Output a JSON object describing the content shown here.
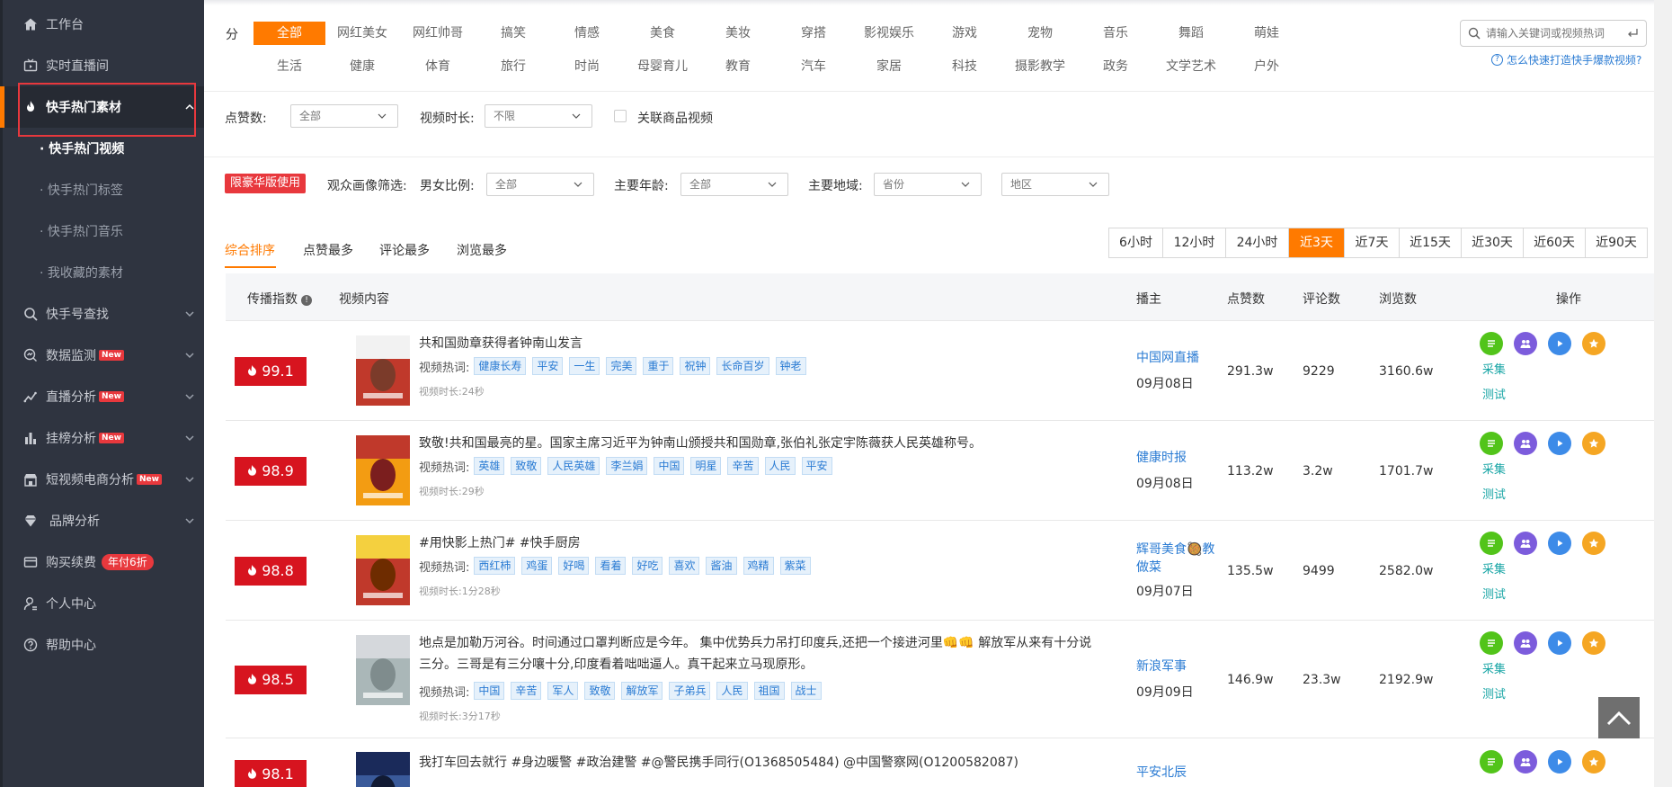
{
  "sidebar": {
    "items": [
      {
        "label": "工作台",
        "icon": "home-icon"
      },
      {
        "label": "实时直播间",
        "icon": "live-icon"
      },
      {
        "label": "快手热门素材",
        "icon": "fire-icon"
      },
      {
        "label": "快手号查找",
        "icon": "search-icon"
      },
      {
        "label": "数据监测",
        "icon": "monitor-icon",
        "badge": "New"
      },
      {
        "label": "直播分析",
        "icon": "trend-icon",
        "badge": "New"
      },
      {
        "label": "挂榜分析",
        "icon": "bar-chart-icon",
        "badge": "New"
      },
      {
        "label": "短视频电商分析",
        "icon": "shop-icon",
        "badge": "New"
      },
      {
        "label": "品牌分析",
        "icon": "diamond-icon"
      },
      {
        "label": "购买续费",
        "icon": "card-icon",
        "badge": "年付6折"
      },
      {
        "label": "个人中心",
        "icon": "user-icon"
      },
      {
        "label": "帮助中心",
        "icon": "help-icon"
      }
    ],
    "subitems": [
      "· 快手热门视频",
      "· 快手热门标签",
      "· 快手热门音乐",
      "· 我收藏的素材"
    ]
  },
  "filters": {
    "category_label": "分 类:",
    "categories_row1": [
      "全部",
      "网红美女",
      "网红帅哥",
      "搞笑",
      "情感",
      "美食",
      "美妆",
      "穿搭",
      "影视娱乐",
      "游戏",
      "宠物",
      "音乐",
      "舞蹈",
      "萌娃"
    ],
    "categories_row2": [
      "生活",
      "健康",
      "体育",
      "旅行",
      "时尚",
      "母婴育儿",
      "教育",
      "汽车",
      "家居",
      "科技",
      "摄影教学",
      "政务",
      "文学艺术",
      "户外"
    ],
    "search_placeholder": "请输入关键词或视频热词",
    "help_link": "怎么快速打造快手爆款视频?",
    "likes_label": "点赞数:",
    "likes_value": "全部",
    "duration_label": "视频时长:",
    "duration_value": "不限",
    "linked_goods_label": "关联商品视频",
    "premium_tag": "限豪华版使用",
    "audience_label": "观众画像筛选:",
    "gender_label": "男女比例:",
    "gender_value": "全部",
    "age_label": "主要年龄:",
    "age_value": "全部",
    "region_label": "主要地域:",
    "province_value": "省份",
    "area_value": "地区"
  },
  "sort_tabs": [
    "综合排序",
    "点赞最多",
    "评论最多",
    "浏览最多"
  ],
  "time_ranges": [
    "6小时",
    "12小时",
    "24小时",
    "近3天",
    "近7天",
    "近15天",
    "近30天",
    "近60天",
    "近90天"
  ],
  "selected_time_range": "近3天",
  "table": {
    "headers": {
      "index": "传播指数",
      "content": "视频内容",
      "author": "播主",
      "likes": "点赞数",
      "comments": "评论数",
      "views": "浏览数",
      "ops": "操作"
    },
    "hot_label": "视频热词:",
    "op_collect": "采集",
    "op_test": "测试",
    "rows": [
      {
        "score": "99.1",
        "title": "共和国勋章获得者钟南山发言",
        "tags": [
          "健康长寿",
          "平安",
          "一生",
          "完美",
          "重于",
          "祝钟",
          "长命百岁",
          "钟老"
        ],
        "duration": "视频时长:24秒",
        "author": "中国网直播",
        "date": "09月08日",
        "likes": "291.3w",
        "comments": "9229",
        "views": "3160.6w"
      },
      {
        "score": "98.9",
        "title": "致敬!共和国最亮的星。国家主席习近平为钟南山颁授共和国勋章,张伯礼张定宇陈薇获人民英雄称号。",
        "tags": [
          "英雄",
          "致敬",
          "人民英雄",
          "李兰娟",
          "中国",
          "明星",
          "辛苦",
          "人民",
          "平安"
        ],
        "duration": "视频时长:29秒",
        "author": "健康时报",
        "date": "09月08日",
        "likes": "113.2w",
        "comments": "3.2w",
        "views": "1701.7w"
      },
      {
        "score": "98.8",
        "title": "#用快影上热门# #快手厨房",
        "tags": [
          "西红柿",
          "鸡蛋",
          "好喝",
          "看着",
          "好吃",
          "喜欢",
          "酱油",
          "鸡精",
          "紫菜"
        ],
        "duration": "视频时长:1分28秒",
        "author": "辉哥美食🥘教做菜",
        "date": "09月07日",
        "likes": "135.5w",
        "comments": "9499",
        "views": "2582.0w"
      },
      {
        "score": "98.5",
        "title": "地点是加勒万河谷。时间通过口罩判断应是今年。 集中优势兵力吊打印度兵,还把一个接进河里👊👊 解放军从来有十分说三分。三哥是有三分嚷十分,印度看着咄咄逼人。真干起来立马现原形。",
        "tags": [
          "中国",
          "辛苦",
          "军人",
          "致敬",
          "解放军",
          "子弟兵",
          "人民",
          "祖国",
          "战士"
        ],
        "duration": "视频时长:3分17秒",
        "author": "新浪军事",
        "date": "09月09日",
        "likes": "146.9w",
        "comments": "23.3w",
        "views": "2192.9w"
      },
      {
        "score": "98.1",
        "title": "我打车回去就行 #身边暖警 #政治建警 #@警民携手同行(O1368505484) @中国警察网(O1200582087)",
        "author": "平安北辰"
      }
    ]
  },
  "colors": {
    "accent": "#ff7a00",
    "sidebar_bg": "#2f3440",
    "score_bg": "#d7141f",
    "link": "#2a7bd3",
    "chip_bg": "#e6f1fb",
    "op_green": "#52c41a",
    "op_purple": "#7c5cdc",
    "op_blue": "#3d8be8",
    "op_orange": "#f5a623"
  }
}
